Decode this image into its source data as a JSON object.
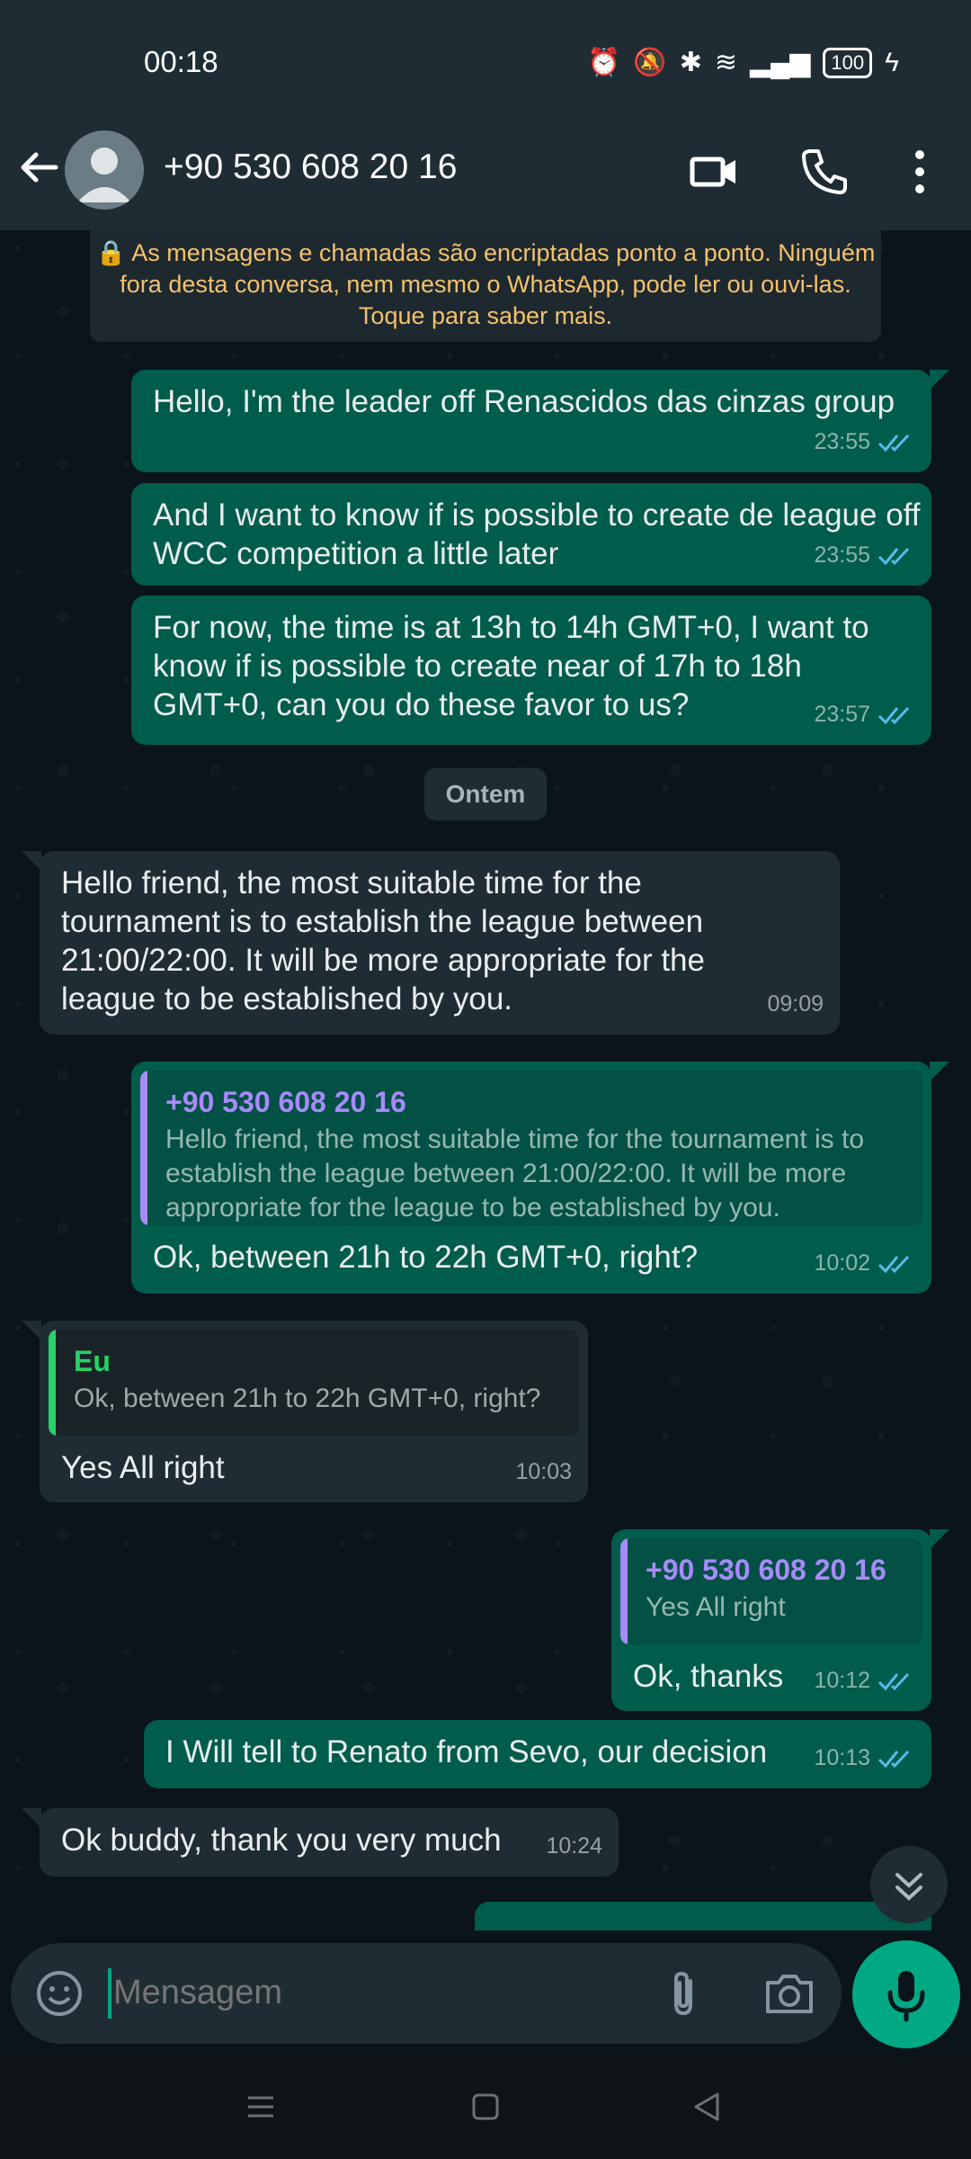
{
  "status_bar": {
    "time": "00:18",
    "battery": "100"
  },
  "header": {
    "contact": "+90 530 608 20 16"
  },
  "system_notice": "🔒 As mensagens e chamadas são encriptadas ponto a ponto. Ninguém fora desta conversa, nem mesmo o WhatsApp, pode ler ou ouvi-las. Toque para saber mais.",
  "date_separator": "Ontem",
  "messages": [
    {
      "dir": "out",
      "text": "Hello, I'm the leader off Renascidos das cinzas group",
      "time": "23:55"
    },
    {
      "dir": "out",
      "text": "And I want to know if is possible to create de league off WCC competition a little later",
      "time": "23:55"
    },
    {
      "dir": "out",
      "text": "For now, the time is at 13h to 14h GMT+0, I want to know if is possible to create near of 17h to 18h GMT+0, can you do these favor to us?",
      "time": "23:57"
    },
    {
      "dir": "in",
      "text": "Hello friend, the most suitable time for the tournament is to establish the league between 21:00/22:00. It will be more appropriate for the league to be established by you.",
      "time": "09:09"
    },
    {
      "dir": "out",
      "quote_name": "+90 530 608 20 16",
      "quote_text": "Hello friend, the most suitable time for the tournament is to establish the league between 21:00/22:00. It will be more appropriate for the league to be established by you.",
      "text": "Ok, between 21h to 22h GMT+0, right?",
      "time": "10:02"
    },
    {
      "dir": "in",
      "quote_name": "Eu",
      "quote_text": "Ok, between 21h to 22h GMT+0, right?",
      "text": "Yes All right",
      "time": "10:03"
    },
    {
      "dir": "out",
      "quote_name": "+90 530 608 20 16",
      "quote_text": "Yes All right",
      "text": "Ok, thanks",
      "time": "10:12"
    },
    {
      "dir": "out",
      "text": "I Will tell to Renato from Sevo, our decision",
      "time": "10:13"
    },
    {
      "dir": "in",
      "text": "Ok buddy, thank you very much",
      "time": "10:24"
    }
  ],
  "input": {
    "placeholder": "Mensagem"
  },
  "colors": {
    "outgoing": "#005c4b",
    "incoming": "#202c33",
    "accent": "#00a884",
    "quote_purple": "#a78bfa",
    "quote_green": "#25d366",
    "read_ticks": "#53bdeb"
  },
  "icons": [
    "back-arrow-icon",
    "video-call-icon",
    "phone-icon",
    "more-options-icon",
    "emoji-icon",
    "attach-icon",
    "camera-icon",
    "mic-icon",
    "scroll-down-icon"
  ]
}
